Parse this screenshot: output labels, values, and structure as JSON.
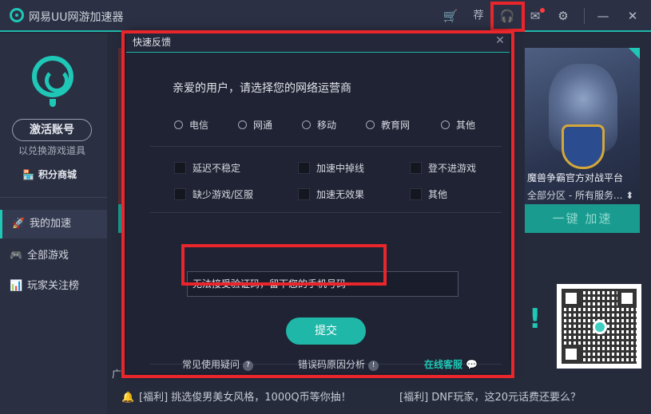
{
  "app": {
    "title": "网易UU网游加速器"
  },
  "titlebar": {
    "icons": [
      "cart-icon",
      "recommend-icon",
      "headset-icon",
      "mail-icon",
      "gear-icon",
      "minimize-icon",
      "close-icon"
    ],
    "recommend_glyph": "荐"
  },
  "sidebar": {
    "activate_label": "激活账号",
    "activate_sub": "以兑换游戏道具",
    "points_mall": "积分商城",
    "items": [
      {
        "label": "我的加速",
        "icon": "rocket-icon",
        "active": true
      },
      {
        "label": "全部游戏",
        "icon": "gamepad-icon",
        "active": false
      },
      {
        "label": "玩家关注榜",
        "icon": "ranking-icon",
        "active": false
      }
    ]
  },
  "banner": {
    "title": "魔兽争霸官方对战平台",
    "sub": "全部分区 - 所有服务...",
    "action": "一键 加速"
  },
  "background_text": {
    "fragment": "广"
  },
  "ticker": {
    "msg1": "[福利] 挑选俊男美女风格，1000Q币等你抽！",
    "msg2": "[福利] DNF玩家，这20元话费还要么？"
  },
  "dialog": {
    "title": "快速反馈",
    "prompt": "亲爱的用户，请选择您的网络运营商",
    "isp_options": [
      "电信",
      "网通",
      "移动",
      "教育网",
      "其他"
    ],
    "issues": [
      "延迟不稳定",
      "加速中掉线",
      "登不进游戏",
      "缺少游戏/区服",
      "加速无效果",
      "其他"
    ],
    "input_value": "无法接受验证码，留下您的手机号码",
    "submit": "提交",
    "footer": {
      "faq": "常见使用疑问",
      "error_codes": "错误码原因分析",
      "online_service": "在线客服"
    }
  },
  "colors": {
    "accent": "#1fc7b6",
    "highlight": "#e8262b",
    "background": "#232838"
  }
}
